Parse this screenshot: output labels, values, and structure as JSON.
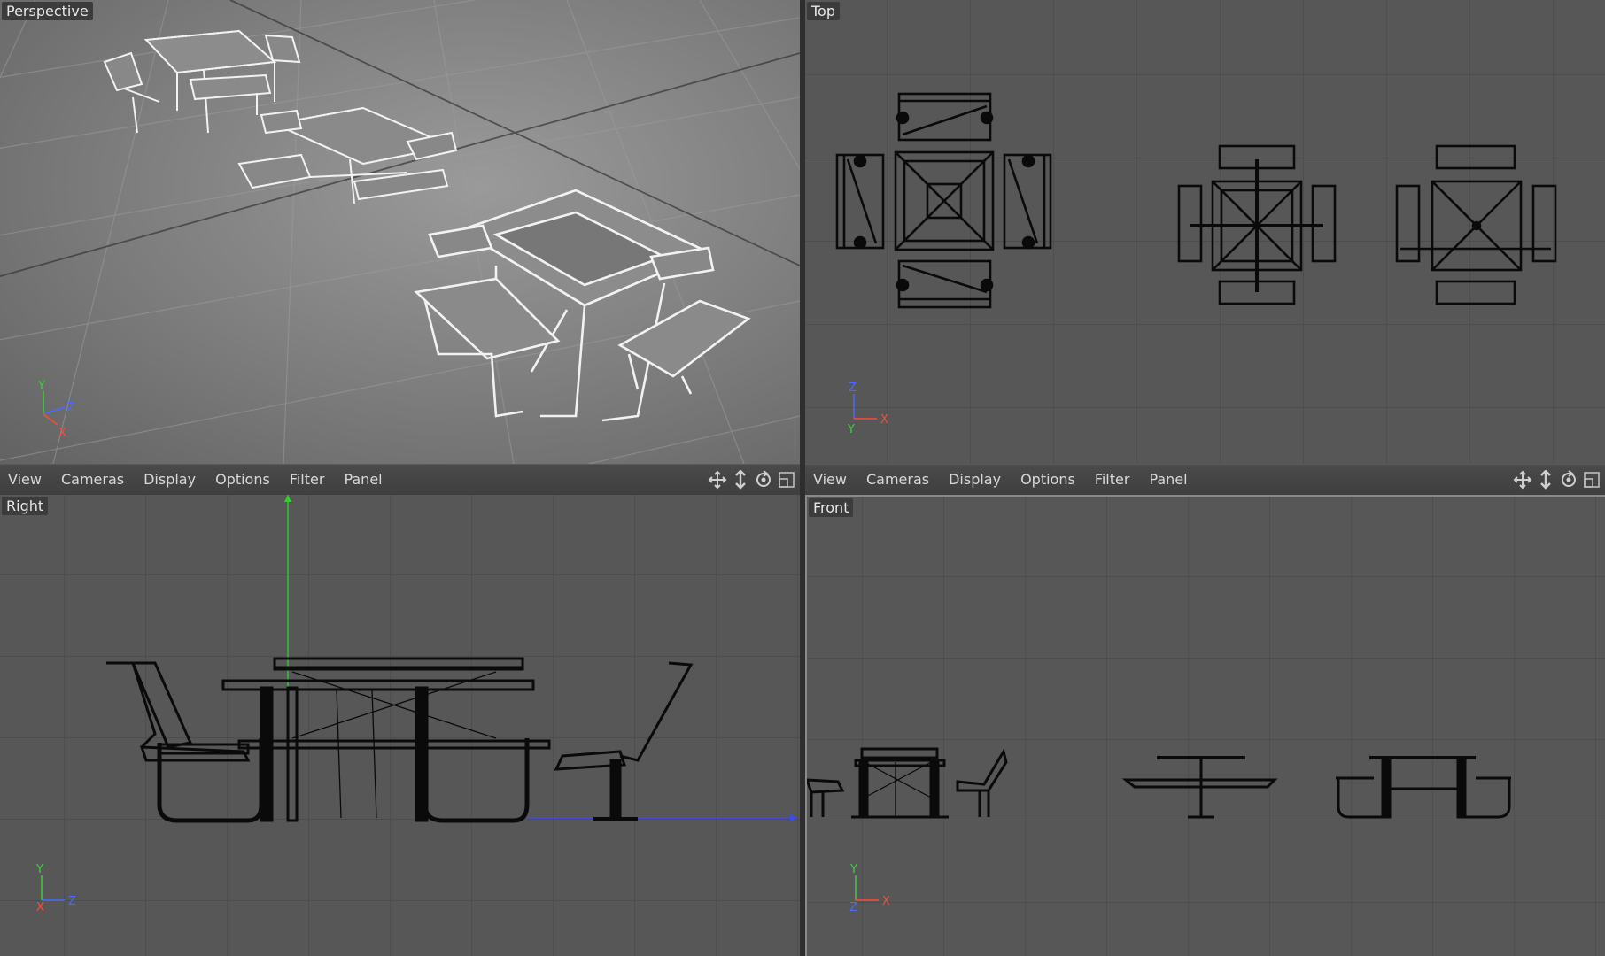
{
  "viewports": {
    "perspective": {
      "label": "Perspective"
    },
    "top": {
      "label": "Top"
    },
    "right": {
      "label": "Right"
    },
    "front": {
      "label": "Front"
    }
  },
  "menubar": {
    "items": [
      "View",
      "Cameras",
      "Display",
      "Options",
      "Filter",
      "Panel"
    ]
  },
  "nav_icons": [
    "move-icon",
    "zoom-icon",
    "rotate-icon",
    "maximize-icon"
  ],
  "axes": {
    "y": "Y",
    "z": "Z",
    "x": "X",
    "colors": {
      "y": "#3fcf3f",
      "z": "#4a6bff",
      "x": "#ff4a3a"
    }
  },
  "colors": {
    "viewport_bg_ortho": "#565656",
    "grid_line": "#4b4b4b",
    "wire_ortho": "#0a0a0a",
    "wire_persp": "#f2f2f2"
  }
}
